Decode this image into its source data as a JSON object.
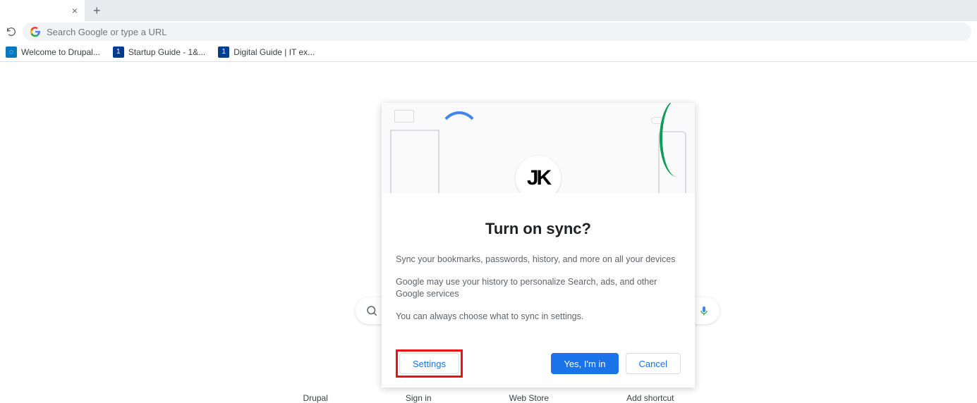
{
  "tab": {
    "close_glyph": "×",
    "new_tab_glyph": "+"
  },
  "omnibox": {
    "placeholder": "Search Google or type a URL"
  },
  "bookmarks": [
    {
      "label": "Welcome to Drupal..."
    },
    {
      "label": "Startup Guide - 1&..."
    },
    {
      "label": "Digital Guide | IT ex..."
    }
  ],
  "dialog": {
    "avatar_initials": "JK",
    "title": "Turn on sync?",
    "line1": "Sync your bookmarks, passwords, history, and more on all your devices",
    "line2": "Google may use your history to personalize Search, ads, and other Google services",
    "line3": "You can always choose what to sync in settings.",
    "settings_label": "Settings",
    "yes_label": "Yes, I'm in",
    "cancel_label": "Cancel"
  },
  "shortcuts": [
    "Drupal",
    "Sign in",
    "Web Store",
    "Add shortcut"
  ]
}
